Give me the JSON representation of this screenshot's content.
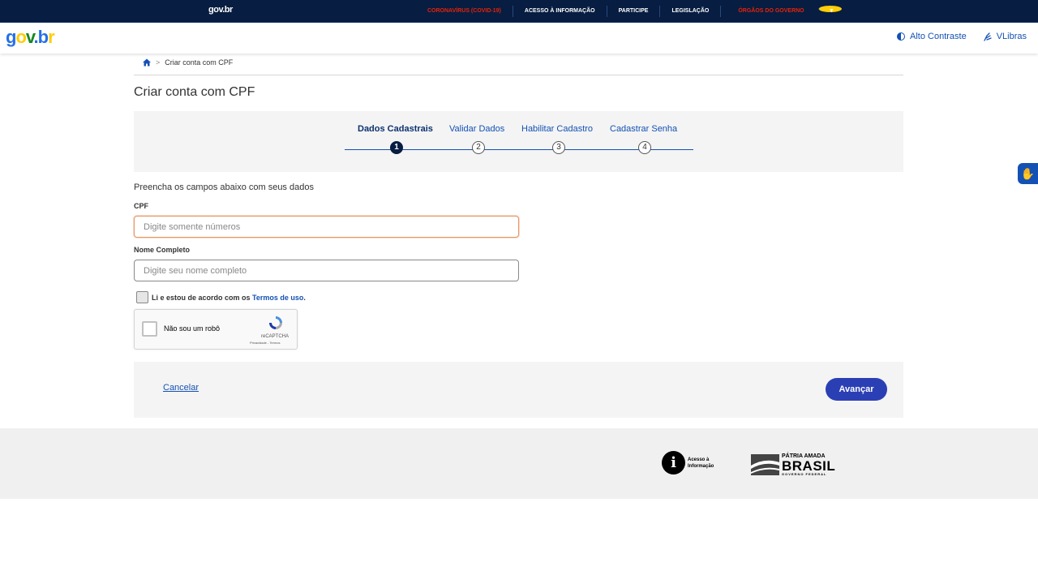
{
  "topbar": {
    "logo": "gov.br",
    "links": [
      {
        "label": "CORONAVÍRUS (COVID-19)"
      },
      {
        "label": "ACESSO À INFORMAÇÃO"
      },
      {
        "label": "PARTICIPE"
      },
      {
        "label": "LEGISLAÇÃO"
      },
      {
        "label": "ÓRGÃOS DO GOVERNO"
      }
    ],
    "colors": {
      "bg": "#071d41",
      "alert": "#e52207",
      "chevron": "#ffcd07"
    }
  },
  "header": {
    "brand": {
      "g": "g",
      "o": "o",
      "v": "v",
      "dot": ".",
      "b": "b",
      "r": "r"
    },
    "high_contrast": "Alto Contraste",
    "vlibras": "VLibras"
  },
  "breadcrumb": {
    "home_icon": "home-icon",
    "separator": ">",
    "current": "Criar conta com CPF"
  },
  "page": {
    "title": "Criar conta com CPF"
  },
  "stepper": {
    "steps": [
      {
        "label": "Dados Cadastrais",
        "number": "1",
        "active": true
      },
      {
        "label": "Validar Dados",
        "number": "2",
        "active": false
      },
      {
        "label": "Habilitar Cadastro",
        "number": "3",
        "active": false
      },
      {
        "label": "Cadastrar Senha",
        "number": "4",
        "active": false
      }
    ]
  },
  "form": {
    "intro": "Preencha os campos abaixo com seus dados",
    "cpf": {
      "label": "CPF",
      "placeholder": "Digite somente números",
      "value": ""
    },
    "name": {
      "label": "Nome Completo",
      "placeholder": "Digite seu nome completo",
      "value": ""
    },
    "terms": {
      "text": "Li e estou de acordo com os ",
      "link": "Termos de uso",
      "suffix": "."
    }
  },
  "recaptcha": {
    "label": "Não sou um robô",
    "brand": "reCAPTCHA",
    "links": "Privacidade - Termos"
  },
  "actions": {
    "cancel": "Cancelar",
    "next": "Avançar"
  },
  "footer": {
    "acesso": {
      "icon": "i",
      "line1": "Acesso à",
      "line2": "Informação"
    },
    "patria": {
      "line1": "PÁTRIA AMADA",
      "line2": "BRASIL",
      "line3": "GOVERNO FEDERAL"
    }
  }
}
